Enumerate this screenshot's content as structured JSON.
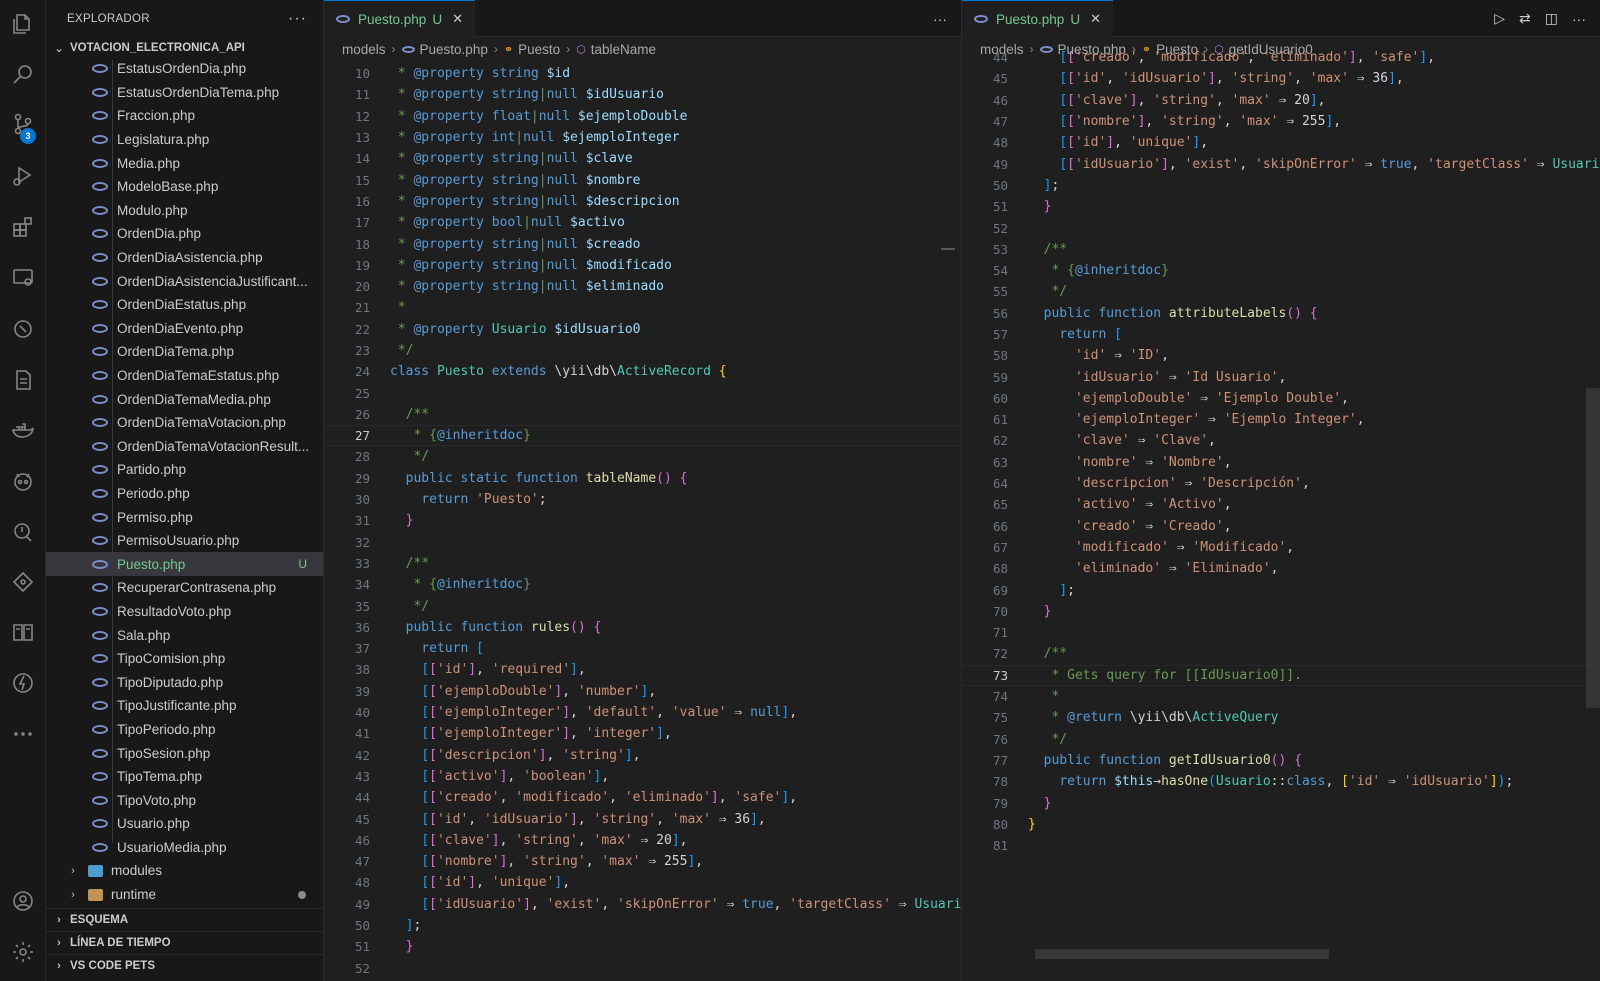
{
  "sidebar": {
    "title": "EXPLORADOR",
    "more": "···",
    "root": "VOTACION_ELECTRONICA_API",
    "files": [
      {
        "name": "EstatusOrdenDia.php"
      },
      {
        "name": "EstatusOrdenDiaTema.php"
      },
      {
        "name": "Fraccion.php"
      },
      {
        "name": "Legislatura.php"
      },
      {
        "name": "Media.php"
      },
      {
        "name": "ModeloBase.php"
      },
      {
        "name": "Modulo.php"
      },
      {
        "name": "OrdenDia.php"
      },
      {
        "name": "OrdenDiaAsistencia.php"
      },
      {
        "name": "OrdenDiaAsistenciaJustificant..."
      },
      {
        "name": "OrdenDiaEstatus.php"
      },
      {
        "name": "OrdenDiaEvento.php"
      },
      {
        "name": "OrdenDiaTema.php"
      },
      {
        "name": "OrdenDiaTemaEstatus.php"
      },
      {
        "name": "OrdenDiaTemaMedia.php"
      },
      {
        "name": "OrdenDiaTemaVotacion.php"
      },
      {
        "name": "OrdenDiaTemaVotacionResult..."
      },
      {
        "name": "Partido.php"
      },
      {
        "name": "Periodo.php"
      },
      {
        "name": "Permiso.php"
      },
      {
        "name": "PermisoUsuario.php"
      },
      {
        "name": "Puesto.php",
        "selected": true,
        "git": "U"
      },
      {
        "name": "RecuperarContrasena.php"
      },
      {
        "name": "ResultadoVoto.php"
      },
      {
        "name": "Sala.php"
      },
      {
        "name": "TipoComision.php"
      },
      {
        "name": "TipoDiputado.php"
      },
      {
        "name": "TipoJustificante.php"
      },
      {
        "name": "TipoPeriodo.php"
      },
      {
        "name": "TipoSesion.php"
      },
      {
        "name": "TipoTema.php"
      },
      {
        "name": "TipoVoto.php"
      },
      {
        "name": "Usuario.php"
      },
      {
        "name": "UsuarioMedia.php"
      }
    ],
    "folders": [
      {
        "name": "modules",
        "color": "#4e9bcd"
      },
      {
        "name": "runtime",
        "color": "#c09553"
      }
    ],
    "sections": [
      "ESQUEMA",
      "LÍNEA DE TIEMPO",
      "VS CODE PETS"
    ]
  },
  "activity_badge": "3",
  "activity_icons": [
    "files-icon",
    "search-icon",
    "source-control-icon",
    "run-debug-icon",
    "extensions-icon",
    "remote-explorer-icon",
    "testing-icon",
    "database-icon",
    "docker-icon",
    "copilot-icon",
    "git-lens-icon",
    "gitkraken-icon",
    "book-icon",
    "lightning-icon",
    "more-icon",
    "account-icon",
    "settings-gear-icon"
  ],
  "left_editor": {
    "tab": {
      "name": "Puesto.php",
      "status": "U",
      "close": "✕"
    },
    "more": "···",
    "breadcrumb": {
      "folder": "models",
      "file": "Puesto.php",
      "class": "Puesto",
      "method": "tableName"
    },
    "active_line": 27
  },
  "right_editor": {
    "tab": {
      "name": "Puesto.php",
      "status": "U",
      "close": "✕"
    },
    "breadcrumb": {
      "folder": "models",
      "file": "Puesto.php",
      "class": "Puesto",
      "method": "getIdUsuario0"
    },
    "active_line": 73
  }
}
